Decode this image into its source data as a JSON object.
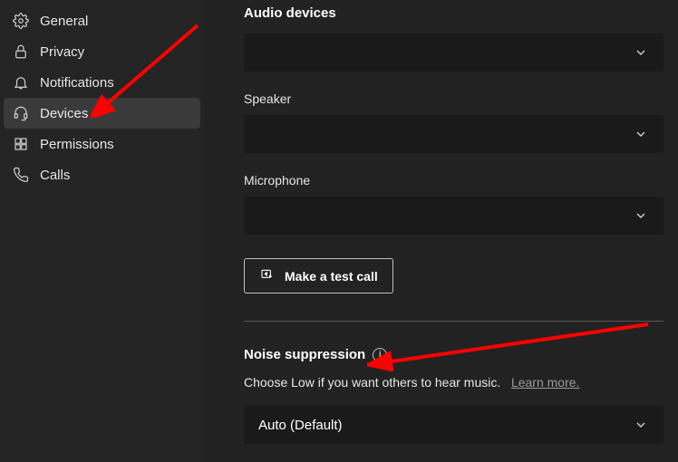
{
  "sidebar": {
    "items": [
      {
        "label": "General",
        "icon": "gear"
      },
      {
        "label": "Privacy",
        "icon": "lock"
      },
      {
        "label": "Notifications",
        "icon": "bell"
      },
      {
        "label": "Devices",
        "icon": "headset",
        "active": true
      },
      {
        "label": "Permissions",
        "icon": "app"
      },
      {
        "label": "Calls",
        "icon": "phone"
      }
    ]
  },
  "audio": {
    "section_title": "Audio devices",
    "device_value": "",
    "speaker_label": "Speaker",
    "speaker_value": "",
    "microphone_label": "Microphone",
    "microphone_value": "",
    "test_call_label": "Make a test call"
  },
  "noise": {
    "title": "Noise suppression",
    "help_text": "Choose Low if you want others to hear music.",
    "learn_more": "Learn more.",
    "value": "Auto (Default)"
  },
  "annotation": {
    "color": "#ff0000"
  }
}
